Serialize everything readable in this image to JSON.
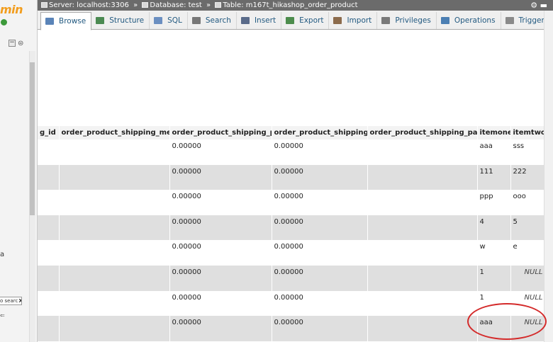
{
  "nav": {
    "logo_text": "min",
    "filter_text": "o searc",
    "filter_clear": "X",
    "db_letter": "a"
  },
  "breadcrumb": {
    "server": "Server: localhost:3306",
    "database": "Database: test",
    "table": "Table: m167t_hikashop_order_product",
    "separator": "»"
  },
  "tabs": [
    {
      "label": "Browse",
      "icon": "browse-icon",
      "color": "#5a84b8",
      "active": true
    },
    {
      "label": "Structure",
      "icon": "structure-icon",
      "color": "#4b8a52"
    },
    {
      "label": "SQL",
      "icon": "sql-icon",
      "color": "#6b8fc1"
    },
    {
      "label": "Search",
      "icon": "search-icon",
      "color": "#777777"
    },
    {
      "label": "Insert",
      "icon": "insert-icon",
      "color": "#5a6b8a"
    },
    {
      "label": "Export",
      "icon": "export-icon",
      "color": "#4c8c4c"
    },
    {
      "label": "Import",
      "icon": "import-icon",
      "color": "#8c6b4c"
    },
    {
      "label": "Privileges",
      "icon": "privileges-icon",
      "color": "#7a7a7a"
    },
    {
      "label": "Operations",
      "icon": "operations-icon",
      "color": "#4b7fb3"
    },
    {
      "label": "Triggers",
      "icon": "triggers-icon",
      "color": "#8a8a8a"
    }
  ],
  "table": {
    "columns": [
      "g_id",
      "order_product_shipping_method",
      "order_product_shipping_price",
      "order_product_shipping_tax",
      "order_product_shipping_params",
      "itemone",
      "itemtwo"
    ],
    "rows": [
      [
        "",
        "",
        "0.00000",
        "0.00000",
        "",
        "aaa",
        "sss"
      ],
      [
        "",
        "",
        "0.00000",
        "0.00000",
        "",
        "111",
        "222"
      ],
      [
        "",
        "",
        "0.00000",
        "0.00000",
        "",
        "ppp",
        "ooo"
      ],
      [
        "",
        "",
        "0.00000",
        "0.00000",
        "",
        "4",
        "5"
      ],
      [
        "",
        "",
        "0.00000",
        "0.00000",
        "",
        "w",
        "e"
      ],
      [
        "",
        "",
        "0.00000",
        "0.00000",
        "",
        "1",
        "NULL"
      ],
      [
        "",
        "",
        "0.00000",
        "0.00000",
        "",
        "1",
        "NULL"
      ],
      [
        "",
        "",
        "0.00000",
        "0.00000",
        "",
        "aaa",
        "NULL"
      ]
    ]
  }
}
